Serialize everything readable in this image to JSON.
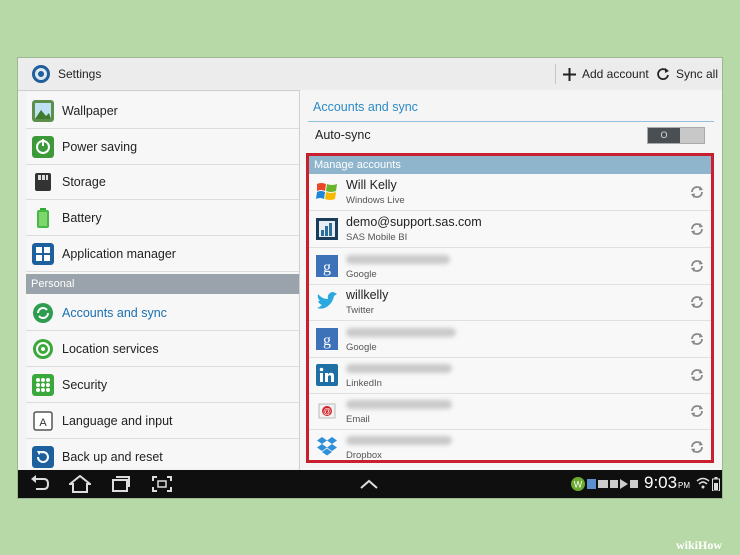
{
  "topbar": {
    "title": "Settings",
    "add_account_label": "Add account",
    "sync_all_label": "Sync all",
    "icons": {
      "app": "settings-gear-icon",
      "add": "plus-icon",
      "sync": "sync-icon"
    }
  },
  "sidebar": {
    "items": [
      {
        "label": "Wallpaper",
        "icon": "wallpaper-icon"
      },
      {
        "label": "Power saving",
        "icon": "power-saving-icon"
      },
      {
        "label": "Storage",
        "icon": "storage-icon"
      },
      {
        "label": "Battery",
        "icon": "battery-icon"
      },
      {
        "label": "Application manager",
        "icon": "app-manager-icon"
      }
    ],
    "section_header": "Personal",
    "personal_items": [
      {
        "label": "Accounts and sync",
        "icon": "accounts-sync-icon",
        "selected": true
      },
      {
        "label": "Location services",
        "icon": "location-icon"
      },
      {
        "label": "Security",
        "icon": "security-icon"
      },
      {
        "label": "Language and input",
        "icon": "language-icon"
      },
      {
        "label": "Back up and reset",
        "icon": "backup-icon"
      }
    ]
  },
  "main": {
    "title": "Accounts and sync",
    "autosync_label": "Auto-sync",
    "autosync_toggle": "O",
    "manage_header": "Manage accounts",
    "accounts": [
      {
        "name": "Will Kelly",
        "type": "Windows Live",
        "icon": "windows-live-icon"
      },
      {
        "name": "demo@support.sas.com",
        "type": "SAS Mobile BI",
        "icon": "sas-mobile-bi-icon"
      },
      {
        "name": "",
        "type": "Google",
        "icon": "google-icon",
        "blurred": true
      },
      {
        "name": "willkelly",
        "type": "Twitter",
        "icon": "twitter-icon"
      },
      {
        "name": "",
        "type": "Google",
        "icon": "google-icon",
        "blurred": true
      },
      {
        "name": "",
        "type": "LinkedIn",
        "icon": "linkedin-icon",
        "blurred": true
      },
      {
        "name": "",
        "type": "Email",
        "icon": "email-icon",
        "blurred": true
      },
      {
        "name": "",
        "type": "Dropbox",
        "icon": "dropbox-icon",
        "blurred": true
      }
    ]
  },
  "statusbar": {
    "time": "9:03",
    "ampm": "PM"
  },
  "watermark": "wikiHow",
  "colors": {
    "accent": "#2b8bc5",
    "highlight_border": "#c81e2e",
    "section_header": "#9aa3ab",
    "manage_header": "#8fb5cd"
  }
}
